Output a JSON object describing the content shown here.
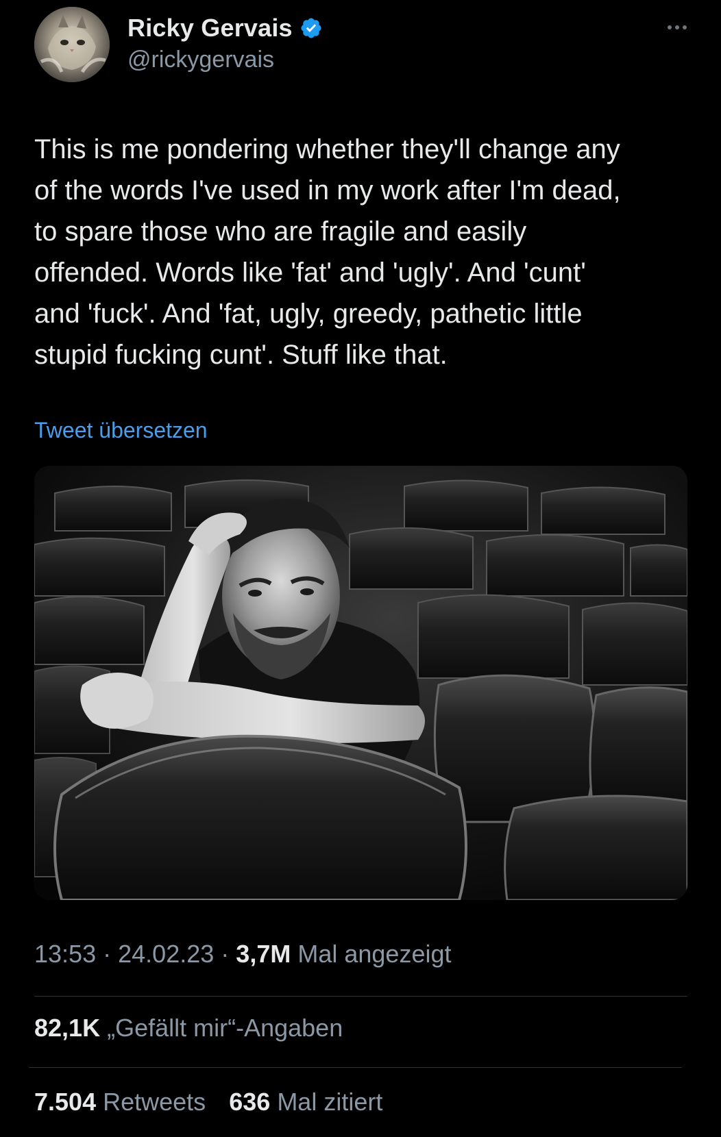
{
  "user": {
    "display_name": "Ricky Gervais",
    "handle": "@rickygervais",
    "verified": true,
    "avatar_icon": "cat-avatar-icon"
  },
  "tweet": {
    "text": "This is me pondering whether they'll change any\nof the words I've used in my work after I'm dead,\nto spare those who are fragile and easily\noffended. Words like 'fat' and 'ugly'. And 'cunt'\nand 'fuck'. And 'fat, ugly, greedy, pathetic little\nstupid fucking cunt'. Stuff like that.",
    "translate_label": "Tweet übersetzen"
  },
  "meta": {
    "time": "13:53",
    "separator": "·",
    "date": "24.02.23",
    "views_count": "3,7M",
    "views_label": "Mal angezeigt"
  },
  "stats": {
    "likes_count": "82,1K",
    "likes_label": "„Gefällt mir“-Angaben",
    "retweets_count": "7.504",
    "retweets_label": "Retweets",
    "quotes_count": "636",
    "quotes_label": "Mal zitiert"
  },
  "colors": {
    "background": "#000000",
    "text": "#e7e9ea",
    "secondary": "#8b98a5",
    "link": "#4a9eea",
    "verified": "#1d9bf0",
    "divider": "#2f3336"
  }
}
